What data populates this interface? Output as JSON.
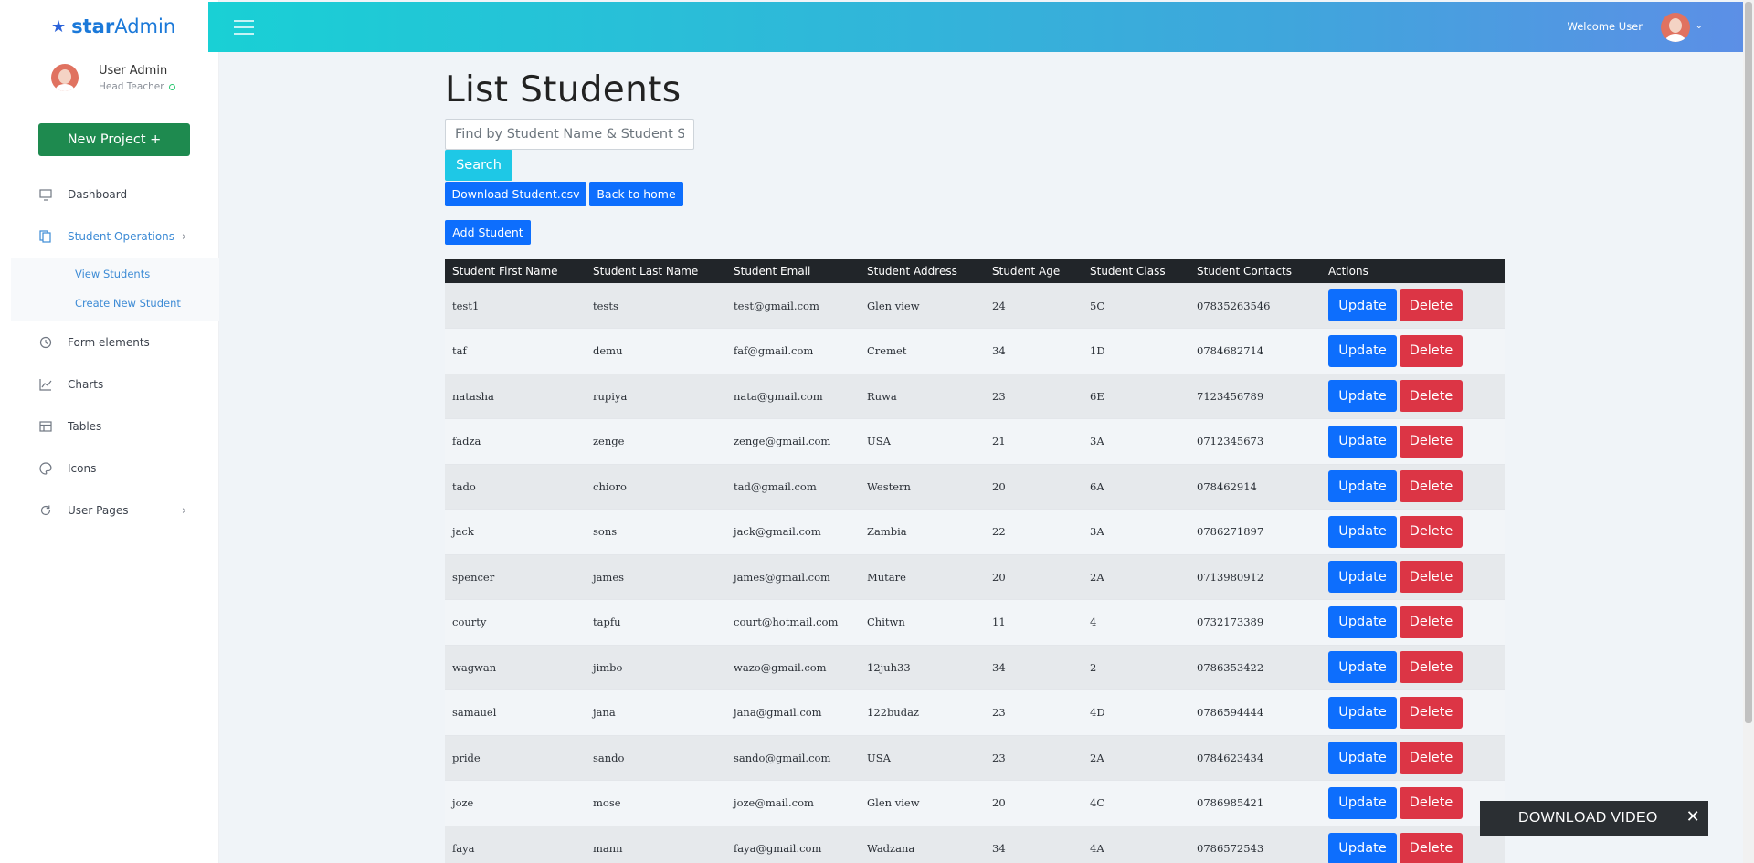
{
  "brand": {
    "name_bold": "star",
    "name_light": "Admin"
  },
  "profile": {
    "name": "User Admin",
    "role": "Head Teacher"
  },
  "sidebar": {
    "new_project": "New Project",
    "new_project_icon": "+",
    "items": [
      {
        "label": "Dashboard",
        "icon": "monitor-icon"
      },
      {
        "label": "Student Operations",
        "icon": "copy-icon"
      },
      {
        "label": "Form elements",
        "icon": "history-icon"
      },
      {
        "label": "Charts",
        "icon": "line-chart-icon"
      },
      {
        "label": "Tables",
        "icon": "table-icon"
      },
      {
        "label": "Icons",
        "icon": "palette-icon"
      },
      {
        "label": "User Pages",
        "icon": "refresh-icon"
      }
    ],
    "subitems": [
      "View Students",
      "Create New Student"
    ]
  },
  "header": {
    "welcome": "Welcome User"
  },
  "main": {
    "title": "List Students",
    "search_placeholder": "Find by Student Name & Student Surname",
    "search_button": "Search",
    "download_button": "Download Student.csv",
    "home_button": "Back to home",
    "add_button": "Add Student",
    "update_label": "Update",
    "delete_label": "Delete"
  },
  "table": {
    "headers": [
      "Student First Name",
      "Student Last Name",
      "Student Email",
      "Student Address",
      "Student Age",
      "Student Class",
      "Student Contacts",
      "Actions"
    ],
    "rows": [
      [
        "test1",
        "tests",
        "test@gmail.com",
        "Glen view",
        "24",
        "5C",
        "07835263546"
      ],
      [
        "taf",
        "demu",
        "faf@gmail.com",
        "Cremet",
        "34",
        "1D",
        "0784682714"
      ],
      [
        "natasha",
        "rupiya",
        "nata@gmail.com",
        "Ruwa",
        "23",
        "6E",
        "7123456789"
      ],
      [
        "fadza",
        "zenge",
        "zenge@gmail.com",
        "USA",
        "21",
        "3A",
        "0712345673"
      ],
      [
        "tado",
        "chioro",
        "tad@gmail.com",
        "Western",
        "20",
        "6A",
        "078462914"
      ],
      [
        "jack",
        "sons",
        "jack@gmail.com",
        "Zambia",
        "22",
        "3A",
        "0786271897"
      ],
      [
        "spencer",
        "james",
        "james@gmail.com",
        "Mutare",
        "20",
        "2A",
        "0713980912"
      ],
      [
        "courty",
        "tapfu",
        "court@hotmail.com",
        "Chitwn",
        "11",
        "4",
        "0732173389"
      ],
      [
        "wagwan",
        "jimbo",
        "wazo@gmail.com",
        "12juh33",
        "34",
        "2",
        "0786353422"
      ],
      [
        "samauel",
        "jana",
        "jana@gmail.com",
        "122budaz",
        "23",
        "4D",
        "0786594444"
      ],
      [
        "pride",
        "sando",
        "sando@gmail.com",
        "USA",
        "23",
        "2A",
        "0784623434"
      ],
      [
        "joze",
        "mose",
        "joze@mail.com",
        "Glen view",
        "20",
        "4C",
        "0786985421"
      ],
      [
        "faya",
        "mann",
        "faya@gmail.com",
        "Wadzana",
        "34",
        "4A",
        "0786572543"
      ]
    ]
  },
  "video_popup": {
    "label": "DOWNLOAD VIDEO",
    "close": "✕"
  },
  "colors": {
    "header_start": "#19d0d5",
    "header_end": "#5c8fe6",
    "primary": "#0d6efd",
    "danger": "#dc3545",
    "success": "#1e8a4f",
    "info": "#1ec8e6"
  }
}
